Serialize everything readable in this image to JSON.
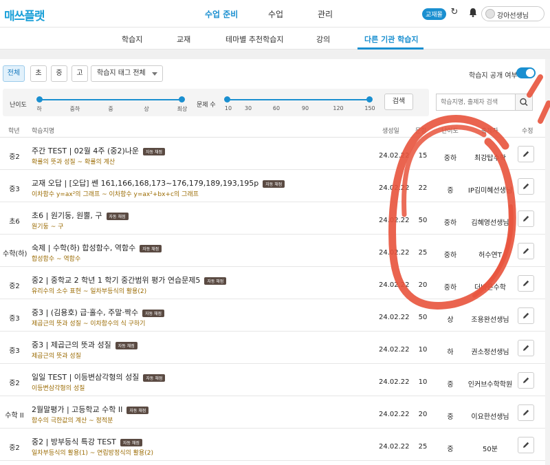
{
  "header": {
    "logo": "매쓰플랫",
    "nav": [
      {
        "label": "수업 준비",
        "active": true
      },
      {
        "label": "수업",
        "active": false
      },
      {
        "label": "관리",
        "active": false
      }
    ],
    "books_badge": "교재몰",
    "user_name": "강아선생님"
  },
  "subnav": {
    "items": [
      {
        "label": "학습지",
        "active": false
      },
      {
        "label": "교재",
        "active": false
      },
      {
        "label": "테마별 추천학습지",
        "active": false
      },
      {
        "label": "강의",
        "active": false
      },
      {
        "label": "다른 기관 학습지",
        "active": true
      }
    ]
  },
  "filters": {
    "grade_chips": [
      {
        "label": "전체",
        "active": true
      },
      {
        "label": "초",
        "active": false
      },
      {
        "label": "중",
        "active": false
      },
      {
        "label": "고",
        "active": false
      }
    ],
    "tag_select": "학습지 태그 전체",
    "public_label": "학습지 공개 여부",
    "public_on": true,
    "difficulty": {
      "label": "난이도",
      "ticks": [
        "하",
        "중하",
        "중",
        "상",
        "최상"
      ]
    },
    "question_count": {
      "label": "문제 수",
      "ticks": [
        "10",
        "30",
        "60",
        "90",
        "120",
        "150"
      ]
    },
    "search_button": "검색",
    "search_placeholder": "학습지명, 출제자 검색"
  },
  "table": {
    "headers": {
      "grade": "학년",
      "name": "학습지명",
      "date": "생성일",
      "count": "문항",
      "difficulty": "난이도",
      "author": "출제자",
      "edit": "수정"
    },
    "rows": [
      {
        "grade": "중2",
        "title": "주간 TEST | 02월 4주 (중2)나운",
        "tag": "자동 채점",
        "range": "확률의 뜻과 성질 ~ 확률의 계산",
        "date": "24.02.22",
        "count": "15",
        "difficulty": "중하",
        "author": "최강탑수학"
      },
      {
        "grade": "중3",
        "title": "교재 오답 | [오답] 쎈 161,166,168,173~176,179,189,193,195p",
        "tag": "자동 채점",
        "range": "이차함수 y=ax²의 그래프 ~ 이차함수 y=ax²+bx+c의 그래프",
        "date": "24.02.22",
        "count": "22",
        "difficulty": "중",
        "author": "IP김미혜선생님"
      },
      {
        "grade": "초6",
        "title": "초6 | 원기둥, 원뿔, 구",
        "tag": "자동 채점",
        "range": "원기둥 ~ 구",
        "date": "24.02.22",
        "count": "50",
        "difficulty": "중하",
        "author": "김혜영선생님"
      },
      {
        "grade": "수학(하)",
        "title": "숙제 | 수학(하) 합성함수, 역함수",
        "tag": "자동 채점",
        "range": "합성함수 ~ 역함수",
        "date": "24.02.22",
        "count": "25",
        "difficulty": "중하",
        "author": "허수연T"
      },
      {
        "grade": "중2",
        "title": "중2 | 중학교 2 학년 1 학기 중간범위 평가 연습문제5",
        "tag": "자동 채점",
        "range": "유리수의 소수 표현 ~ 일차부등식의 활용(2)",
        "date": "24.02.22",
        "count": "20",
        "difficulty": "중하",
        "author": "더바른수학"
      },
      {
        "grade": "중3",
        "title": "중3 | (김용호) 급·홀수, 주말·짝수",
        "tag": "자동 채점",
        "range": "제곱근의 뜻과 성질 ~ 이차함수의 식 구하기",
        "date": "24.02.22",
        "count": "50",
        "difficulty": "상",
        "author": "조용완선생님"
      },
      {
        "grade": "중3",
        "title": "중3 | 제곱근의 뜻과 성질",
        "tag": "자동 채점",
        "range": "제곱근의 뜻과 성질",
        "date": "24.02.22",
        "count": "10",
        "difficulty": "하",
        "author": "권소정선생님"
      },
      {
        "grade": "중2",
        "title": "일일 TEST | 이등변삼각형의 성질",
        "tag": "자동 채점",
        "range": "이등변삼각형의 성질",
        "date": "24.02.22",
        "count": "10",
        "difficulty": "중",
        "author": "인커브수학학원"
      },
      {
        "grade": "수학 II",
        "title": "2월말평가 | 고등학교 수학 II",
        "tag": "자동 채점",
        "range": "함수의 극한값의 계산 ~ 정적분",
        "date": "24.02.22",
        "count": "20",
        "difficulty": "중",
        "author": "이요한선생님"
      },
      {
        "grade": "중2",
        "title": "중2 | 방부등식 특강 TEST",
        "tag": "자동 채점",
        "range": "일차부등식의 활용(1) ~ 연립방정식의 활용(2)",
        "date": "24.02.22",
        "count": "25",
        "difficulty": "중",
        "author": "50분"
      }
    ]
  },
  "colors": {
    "brand": "#1aa0d8",
    "accent": "#1a8fd0",
    "range_text": "#9a6a00",
    "annotation": "#e8533c"
  }
}
